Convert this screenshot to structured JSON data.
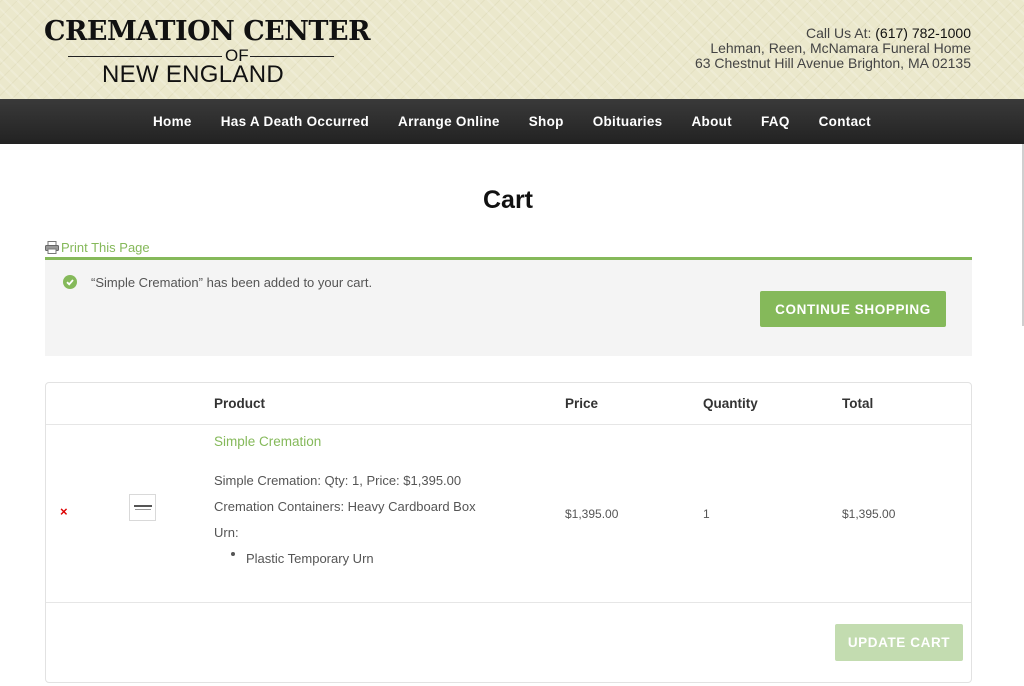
{
  "header": {
    "logo": {
      "line1": "CREMATION CENTER",
      "line2": "OF",
      "line3": "NEW ENGLAND"
    },
    "contact": {
      "call_label": "Call Us At:",
      "phone": "(617) 782-1000",
      "business": "Lehman, Reen, McNamara Funeral Home",
      "address": "63 Chestnut Hill Avenue Brighton, MA 02135"
    }
  },
  "nav": {
    "items": [
      {
        "label": "Home"
      },
      {
        "label": "Has A Death Occurred"
      },
      {
        "label": "Arrange Online"
      },
      {
        "label": "Shop"
      },
      {
        "label": "Obituaries"
      },
      {
        "label": "About"
      },
      {
        "label": "FAQ"
      },
      {
        "label": "Contact"
      }
    ]
  },
  "page": {
    "title": "Cart",
    "print_label": "Print This Page"
  },
  "notice": {
    "message": "“Simple Cremation” has been added to your cart.",
    "continue_label": "CONTINUE SHOPPING"
  },
  "cart": {
    "headers": {
      "product": "Product",
      "price": "Price",
      "quantity": "Quantity",
      "total": "Total"
    },
    "item": {
      "remove_label": "×",
      "name": "Simple Cremation",
      "detail1": "Simple Cremation: Qty: 1, Price: $1,395.00",
      "detail2": "Cremation Containers: Heavy Cardboard Box",
      "urn_label": "Urn:",
      "urn_choice": "Plastic Temporary Urn",
      "price": "$1,395.00",
      "quantity": "1",
      "total": "$1,395.00"
    },
    "update_label": "UPDATE CART"
  },
  "colors": {
    "accent": "#85b95a",
    "nav_bg": "#2b2b2b",
    "header_bg": "#ebe8cc",
    "remove": "#dd0000"
  }
}
